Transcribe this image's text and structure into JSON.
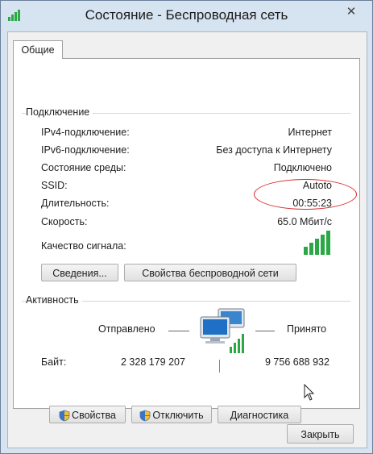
{
  "window": {
    "title": "Состояние - Беспроводная сеть",
    "close_glyph": "✕"
  },
  "tabs": [
    {
      "label": "Общие"
    }
  ],
  "connection": {
    "section_title": "Подключение",
    "rows": [
      {
        "label": "IPv4-подключение:",
        "value": "Интернет"
      },
      {
        "label": "IPv6-подключение:",
        "value": "Без доступа к Интернету"
      },
      {
        "label": "Состояние среды:",
        "value": "Подключено"
      },
      {
        "label": "SSID:",
        "value": "Autoto"
      },
      {
        "label": "Длительность:",
        "value": "00:55:23"
      },
      {
        "label": "Скорость:",
        "value": "65.0 Мбит/с"
      }
    ],
    "signal_label": "Качество сигнала:",
    "signal_bars": 5,
    "signal_bars_filled": 5,
    "details_button": "Сведения...",
    "wireless_props_button": "Свойства беспроводной сети"
  },
  "activity": {
    "section_title": "Активность",
    "sent_label": "Отправлено",
    "received_label": "Принято",
    "bytes_label": "Байт:",
    "bytes_sent": "2 328 179 207",
    "bytes_received": "9 756 688 932"
  },
  "actions": {
    "properties_button": "Свойства",
    "disable_button": "Отключить",
    "diagnose_button": "Диагностика"
  },
  "footer": {
    "close_button": "Закрыть"
  },
  "colors": {
    "accent": "#2aa845",
    "annotation": "#d8262a",
    "titlebar": "#d6e3f1"
  },
  "icons": [
    "wifi-signal-icon",
    "network-computers-icon",
    "shield-icon",
    "mouse-pointer-icon"
  ]
}
